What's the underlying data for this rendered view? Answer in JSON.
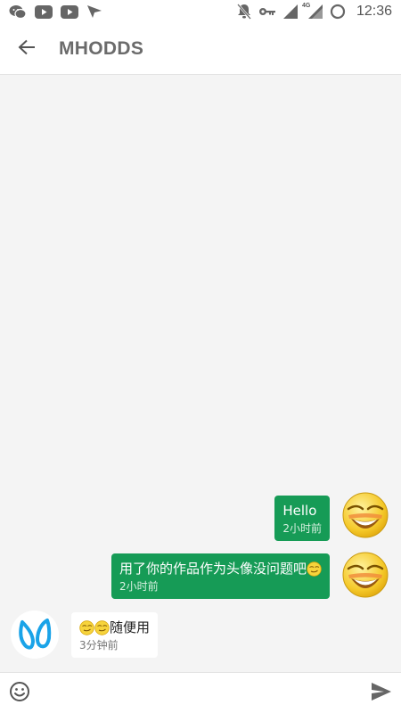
{
  "status_bar": {
    "time": "12:36",
    "network_label": "4G",
    "left_icons": [
      "wechat-icon",
      "youtube-icon",
      "youtube-icon",
      "send-arrow-icon"
    ],
    "right_icons": [
      "notifications-off-icon",
      "key-icon",
      "signal-icon",
      "signal-4g-icon",
      "sync-circle-icon"
    ]
  },
  "app_bar": {
    "title": "MHODDS",
    "back_icon": "arrow-left-icon"
  },
  "messages": [
    {
      "direction": "outgoing",
      "text": "Hello",
      "time": "2小时前",
      "avatar": "laughing-emoji-avatar"
    },
    {
      "direction": "outgoing",
      "text": "用了你的作品作为头像没问题吧",
      "trailing_emoji": "smirk-emoji-icon",
      "time": "2小时前",
      "avatar": "laughing-emoji-avatar"
    },
    {
      "direction": "incoming",
      "leading_emojis": [
        "smirk-emoji-icon",
        "smirk-emoji-icon"
      ],
      "text": "随便用",
      "time": "3分钟前",
      "avatar": "blue-loop-logo-avatar"
    }
  ],
  "input_bar": {
    "placeholder": "",
    "emoji_icon": "smiley-icon",
    "send_icon": "send-icon"
  },
  "colors": {
    "outgoing_bubble": "#169b56",
    "incoming_bubble": "#ffffff",
    "chat_background": "#f4f4f4",
    "logo_blue": "#1aa3e8"
  }
}
